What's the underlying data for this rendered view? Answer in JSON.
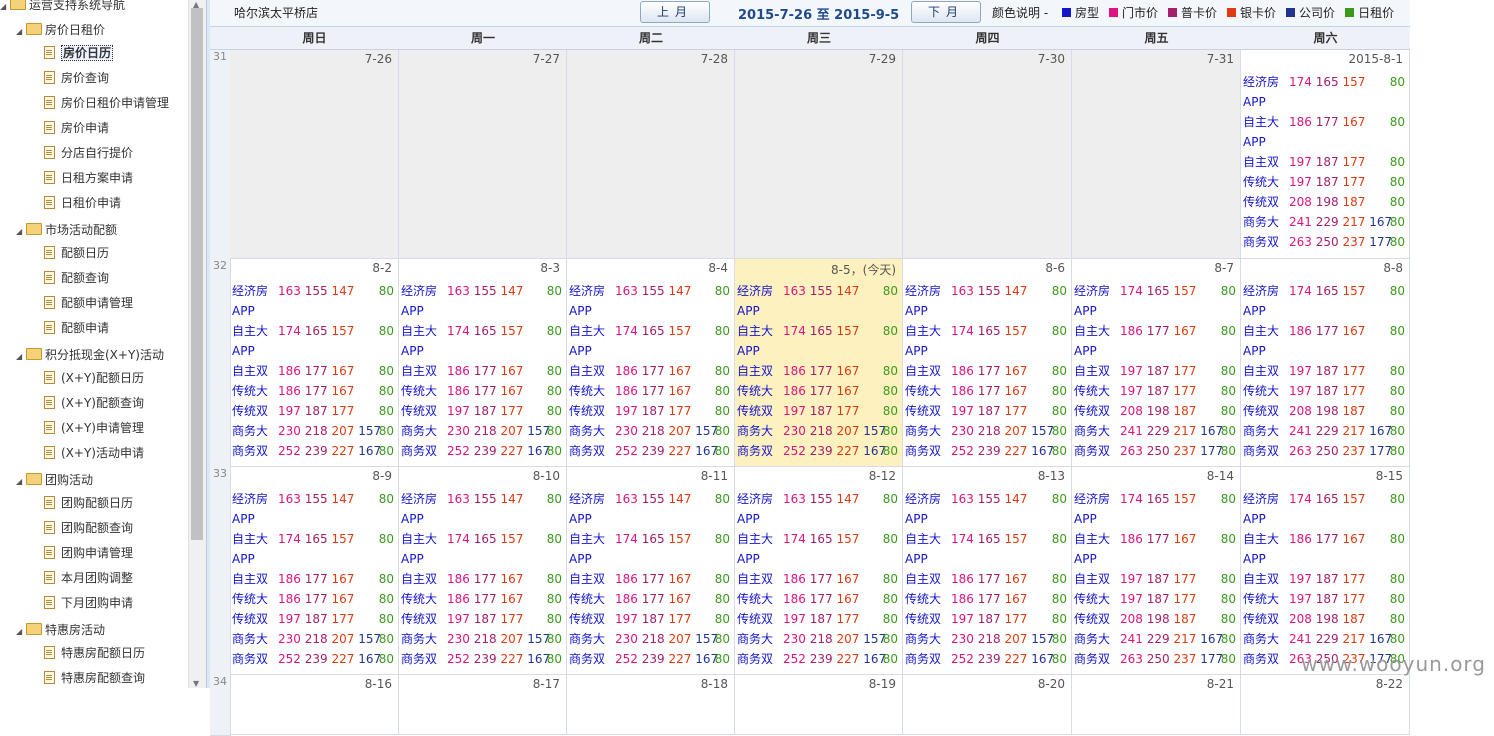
{
  "sidebar": {
    "root": "运营支持系统导航",
    "groups": [
      {
        "label": "房价日租价",
        "items": [
          "房价日历",
          "房价查询",
          "房价日租价申请管理",
          "房价申请",
          "分店自行提价",
          "日租方案申请",
          "日租价申请"
        ]
      },
      {
        "label": "市场活动配额",
        "items": [
          "配额日历",
          "配额查询",
          "配额申请管理",
          "配额申请"
        ]
      },
      {
        "label": "积分抵现金(X+Y)活动",
        "items": [
          "(X+Y)配额日历",
          "(X+Y)配额查询",
          "(X+Y)申请管理",
          "(X+Y)活动申请"
        ]
      },
      {
        "label": "团购活动",
        "items": [
          "团购配额日历",
          "团购配额查询",
          "团购申请管理",
          "本月团购调整",
          "下月团购申请"
        ]
      },
      {
        "label": "特惠房活动",
        "items": [
          "特惠房配额日历",
          "特惠房配额查询"
        ]
      }
    ],
    "selected": "房价日历"
  },
  "toolbar": {
    "hotel": "哈尔滨太平桥店",
    "prev": "上月",
    "next": "下月",
    "range": "2015-7-26 至 2015-9-5",
    "legend_title": "颜色说明 -",
    "legend": [
      {
        "label": "房型",
        "color": "#1515cc"
      },
      {
        "label": "门市价",
        "color": "#e0127f"
      },
      {
        "label": "普卡价",
        "color": "#a4206a"
      },
      {
        "label": "银卡价",
        "color": "#e03a10"
      },
      {
        "label": "公司价",
        "color": "#22348f"
      },
      {
        "label": "日租价",
        "color": "#3a9a1c"
      }
    ]
  },
  "weekdays": [
    "周日",
    "周一",
    "周二",
    "周三",
    "周四",
    "周五",
    "周六"
  ],
  "weeks": [
    {
      "num": "31",
      "days": [
        {
          "date": "7-26",
          "past": true,
          "set": null
        },
        {
          "date": "7-27",
          "past": true,
          "set": null
        },
        {
          "date": "7-28",
          "past": true,
          "set": null
        },
        {
          "date": "7-29",
          "past": true,
          "set": null
        },
        {
          "date": "7-30",
          "past": true,
          "set": null
        },
        {
          "date": "7-31",
          "past": true,
          "set": null
        },
        {
          "date": "2015-8-1",
          "set": "B"
        }
      ]
    },
    {
      "num": "32",
      "days": [
        {
          "date": "8-2",
          "set": "A"
        },
        {
          "date": "8-3",
          "set": "A"
        },
        {
          "date": "8-4",
          "set": "A"
        },
        {
          "date": "8-5，(今天)",
          "today": true,
          "set": "A"
        },
        {
          "date": "8-6",
          "set": "A"
        },
        {
          "date": "8-7",
          "set": "B"
        },
        {
          "date": "8-8",
          "set": "B"
        }
      ]
    },
    {
      "num": "33",
      "days": [
        {
          "date": "8-9",
          "set": "A"
        },
        {
          "date": "8-10",
          "set": "A"
        },
        {
          "date": "8-11",
          "set": "A"
        },
        {
          "date": "8-12",
          "set": "A"
        },
        {
          "date": "8-13",
          "set": "A"
        },
        {
          "date": "8-14",
          "set": "B"
        },
        {
          "date": "8-15",
          "set": "B"
        }
      ]
    },
    {
      "num": "34",
      "days": [
        {
          "date": "8-16",
          "set": null
        },
        {
          "date": "8-17",
          "set": null
        },
        {
          "date": "8-18",
          "set": null
        },
        {
          "date": "8-19",
          "set": null
        },
        {
          "date": "8-20",
          "set": null
        },
        {
          "date": "8-21",
          "set": null
        },
        {
          "date": "8-22",
          "set": null
        }
      ]
    }
  ],
  "rate_sets": {
    "A": [
      {
        "room": "经济房",
        "p": [
          "163",
          "155",
          "147",
          ""
        ],
        "day": "80"
      },
      {
        "room": "APP",
        "p": [
          "",
          "",
          "",
          ""
        ],
        "day": ""
      },
      {
        "room": "自主大",
        "p": [
          "174",
          "165",
          "157",
          ""
        ],
        "day": "80"
      },
      {
        "room": "APP",
        "p": [
          "",
          "",
          "",
          ""
        ],
        "day": ""
      },
      {
        "room": "自主双",
        "p": [
          "186",
          "177",
          "167",
          ""
        ],
        "day": "80"
      },
      {
        "room": "传统大",
        "p": [
          "186",
          "177",
          "167",
          ""
        ],
        "day": "80"
      },
      {
        "room": "传统双",
        "p": [
          "197",
          "187",
          "177",
          ""
        ],
        "day": "80"
      },
      {
        "room": "商务大",
        "p": [
          "230",
          "218",
          "207",
          "157"
        ],
        "day": "80"
      },
      {
        "room": "商务双",
        "p": [
          "252",
          "239",
          "227",
          "167"
        ],
        "day": "80"
      }
    ],
    "B": [
      {
        "room": "经济房",
        "p": [
          "174",
          "165",
          "157",
          ""
        ],
        "day": "80"
      },
      {
        "room": "APP",
        "p": [
          "",
          "",
          "",
          ""
        ],
        "day": ""
      },
      {
        "room": "自主大",
        "p": [
          "186",
          "177",
          "167",
          ""
        ],
        "day": "80"
      },
      {
        "room": "APP",
        "p": [
          "",
          "",
          "",
          ""
        ],
        "day": ""
      },
      {
        "room": "自主双",
        "p": [
          "197",
          "187",
          "177",
          ""
        ],
        "day": "80"
      },
      {
        "room": "传统大",
        "p": [
          "197",
          "187",
          "177",
          ""
        ],
        "day": "80"
      },
      {
        "room": "传统双",
        "p": [
          "208",
          "198",
          "187",
          ""
        ],
        "day": "80"
      },
      {
        "room": "商务大",
        "p": [
          "241",
          "229",
          "217",
          "167"
        ],
        "day": "80"
      },
      {
        "room": "商务双",
        "p": [
          "263",
          "250",
          "237",
          "177"
        ],
        "day": "80"
      }
    ]
  },
  "watermark": "www.wooyun.org"
}
